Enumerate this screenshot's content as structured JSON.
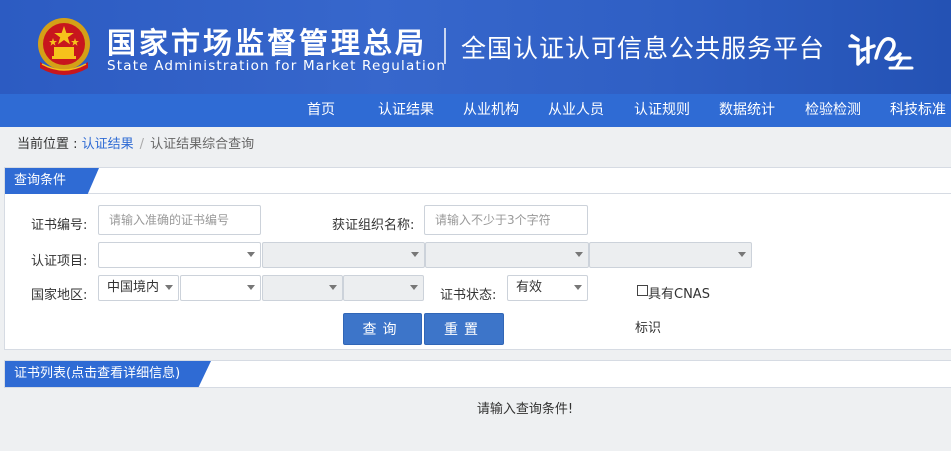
{
  "header": {
    "agency_cn": "国家市场监督管理总局",
    "agency_en": "State Administration  for  Market Regulation",
    "platform": "全国认证认可信息公共服务平台"
  },
  "nav": {
    "items": [
      "首页",
      "认证结果",
      "从业机构",
      "从业人员",
      "认证规则",
      "数据统计",
      "检验检测",
      "科技标准"
    ]
  },
  "breadcrumb": {
    "prefix": "当前位置 : ",
    "link": "认证结果",
    "sep": "/",
    "current": "认证结果综合查询"
  },
  "query": {
    "title": "查询条件",
    "cert_no_label": "证书编号:",
    "cert_no_placeholder": "请输入准确的证书编号",
    "org_label": "获证组织名称:",
    "org_placeholder": "请输入不少于3个字符",
    "project_label": "认证项目:",
    "region_label": "国家地区:",
    "region_value": "中国境内",
    "status_label": "证书状态:",
    "status_value": "有效",
    "cnas_label": "具有CNAS",
    "cnas_label2": "标识",
    "search_button": "查询",
    "reset_button": "重置"
  },
  "list": {
    "title": "证书列表(点击查看详细信息)",
    "empty_message": "请输入查询条件!"
  },
  "colors": {
    "banner": "#2a56b8",
    "nav": "#2f6bd4",
    "button": "#3d75c9"
  }
}
